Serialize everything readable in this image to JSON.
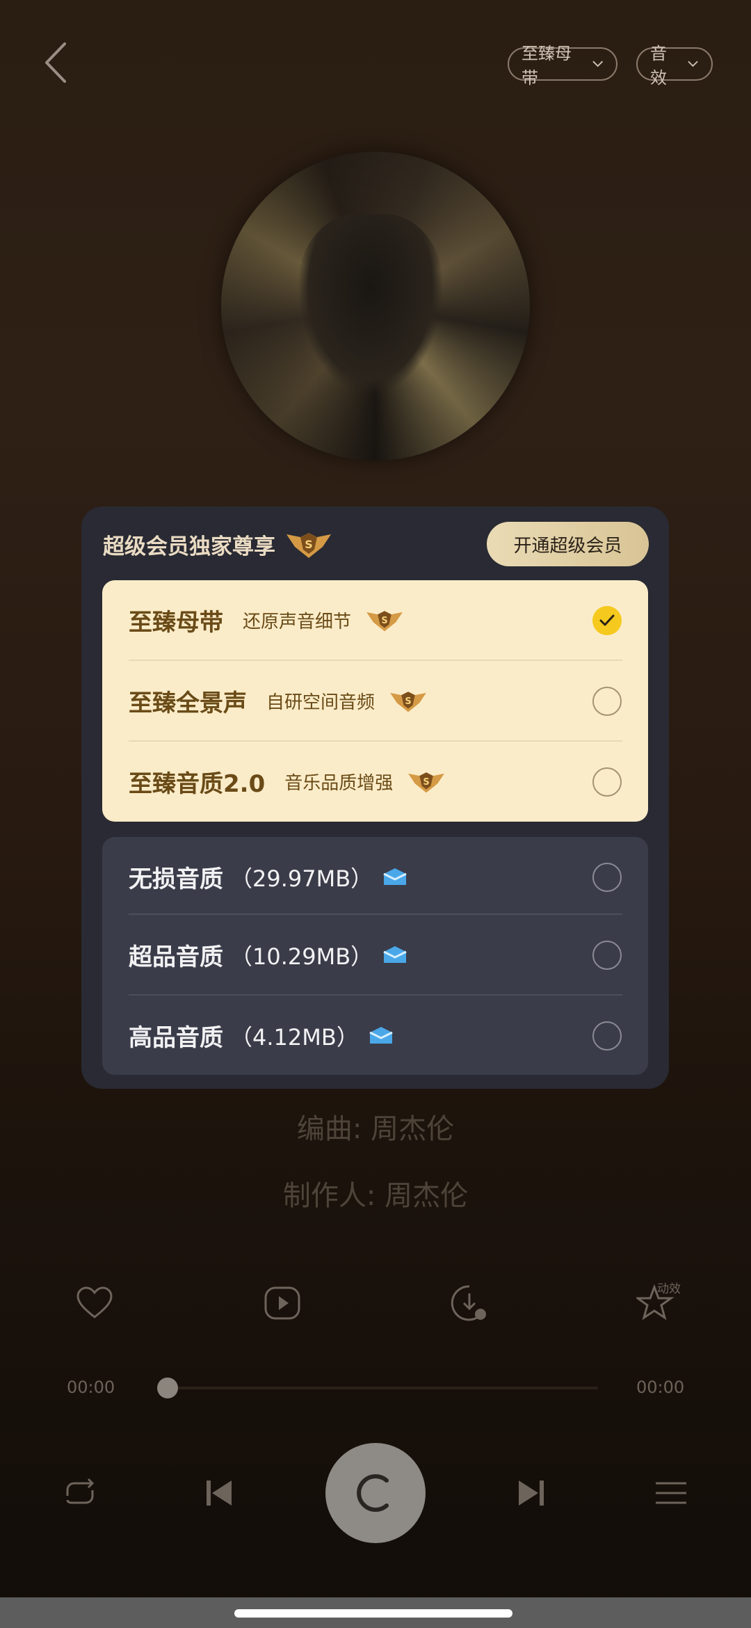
{
  "header": {
    "quality_chip": "至臻母带",
    "effect_chip": "音效"
  },
  "credits": {
    "arranger": "编曲: 周杰伦",
    "producer": "制作人: 周杰伦"
  },
  "sheet": {
    "title": "超级会员独家尊享",
    "open_vip_button": "开通超级会员",
    "premium_options": [
      {
        "title": "至臻母带",
        "subtitle": "还原声音细节",
        "selected": true
      },
      {
        "title": "至臻全景声",
        "subtitle": "自研空间音频",
        "selected": false
      },
      {
        "title": "至臻音质2.0",
        "subtitle": "音乐品质增强",
        "selected": false
      }
    ],
    "standard_options": [
      {
        "title": "无损音质",
        "size": "（29.97MB）",
        "selected": false
      },
      {
        "title": "超品音质",
        "size": "（10.29MB）",
        "selected": false
      },
      {
        "title": "高品音质",
        "size": "（4.12MB）",
        "selected": false
      }
    ]
  },
  "player": {
    "current_time": "00:00",
    "total_time": "00:00",
    "progress": 0,
    "effect_badge": "动效"
  },
  "colors": {
    "accent_gold": "#f5c91e",
    "premium_card_bg": "#fbecc9",
    "sheet_bg": "#292a33"
  }
}
